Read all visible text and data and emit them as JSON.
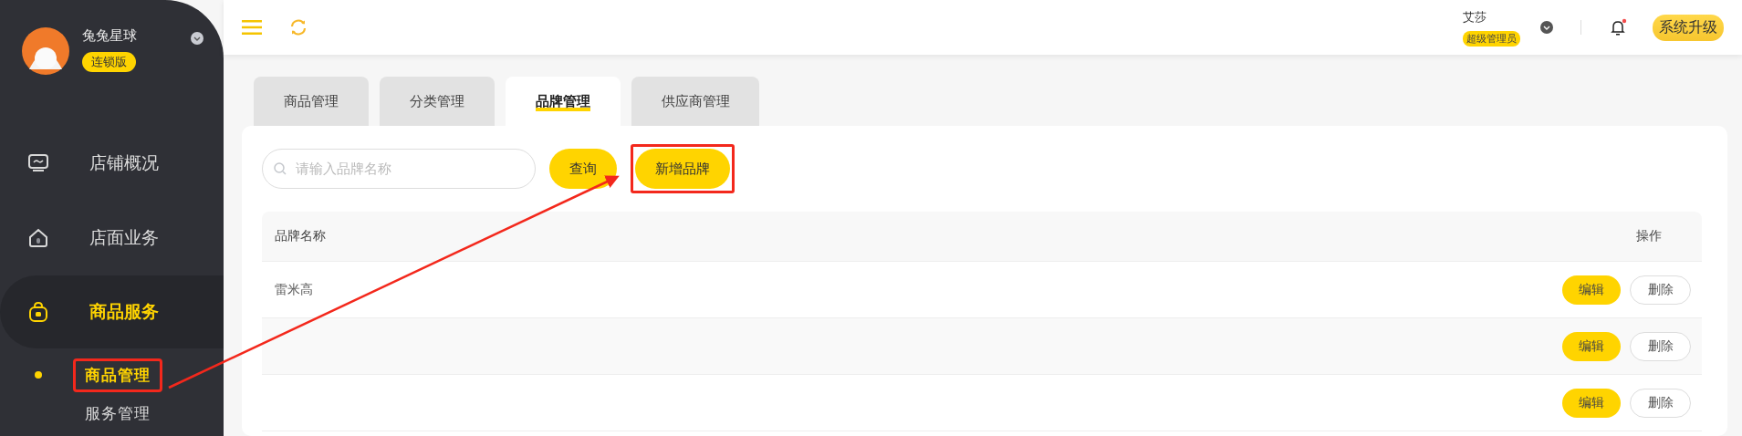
{
  "sidebar": {
    "user": {
      "name": "兔兔星球",
      "badge": "连锁版"
    },
    "items": [
      {
        "label": "店铺概况",
        "selected": false
      },
      {
        "label": "店面业务",
        "selected": false
      },
      {
        "label": "商品服务",
        "selected": true,
        "children": [
          {
            "label": "商品管理",
            "selected": true,
            "highlighted": true
          },
          {
            "label": "服务管理",
            "selected": false,
            "highlighted": false
          }
        ]
      }
    ]
  },
  "top_bar": {
    "user_name": "艾莎",
    "role": "超级管理员",
    "has_notification": true,
    "upgrade_button": "系统升级"
  },
  "tabs": [
    {
      "label": "商品管理",
      "selected": false
    },
    {
      "label": "分类管理",
      "selected": false
    },
    {
      "label": "品牌管理",
      "selected": true
    },
    {
      "label": "供应商管理",
      "selected": false
    }
  ],
  "toolbar": {
    "search": {
      "placeholder": "请输入品牌名称"
    },
    "buttons": [
      {
        "label": "查询",
        "highlighted": false
      },
      {
        "label": "新增品牌",
        "highlighted": true
      }
    ]
  },
  "table": {
    "columns": [
      "品牌名称",
      "操作"
    ],
    "rows": [
      {
        "name": "雷米高",
        "actions": [
          "编辑",
          "删除"
        ]
      },
      {
        "actions": [
          "编辑",
          "删除"
        ]
      },
      {
        "actions": [
          "编辑",
          "删除"
        ]
      }
    ]
  }
}
